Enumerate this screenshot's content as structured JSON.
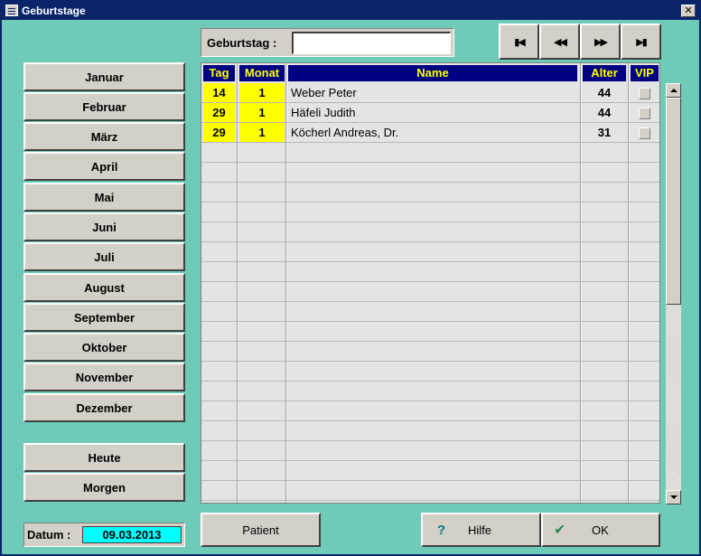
{
  "window": {
    "title": "Geburtstage",
    "close_label": "✕"
  },
  "search": {
    "label": "Geburtstag :",
    "value": ""
  },
  "nav": {
    "first": "▮◀",
    "prev": "◀◀",
    "next": "▶▶",
    "last": "▶▮"
  },
  "months": [
    "Januar",
    "Februar",
    "März",
    "April",
    "Mai",
    "Juni",
    "Juli",
    "August",
    "September",
    "Oktober",
    "November",
    "Dezember"
  ],
  "quick": {
    "today": "Heute",
    "tomorrow": "Morgen"
  },
  "datum": {
    "label": "Datum :",
    "value": "09.03.2013"
  },
  "table": {
    "headers": {
      "tag": "Tag",
      "monat": "Monat",
      "name": "Name",
      "alter": "Alter",
      "vip": "VIP"
    },
    "rows": [
      {
        "tag": "14",
        "monat": "1",
        "name": "Weber Peter",
        "alter": "44",
        "vip": false
      },
      {
        "tag": "29",
        "monat": "1",
        "name": "Häfeli Judith",
        "alter": "44",
        "vip": false
      },
      {
        "tag": "29",
        "monat": "1",
        "name": "Köcherl Andreas, Dr.",
        "alter": "31",
        "vip": false
      }
    ]
  },
  "buttons": {
    "patient": "Patient",
    "help": "Hilfe",
    "help_glyph": "?",
    "ok": "OK",
    "ok_glyph": "✔"
  },
  "colors": {
    "window_bg": "#6ecbb8",
    "header_bg": "#000080",
    "header_fg": "#ffff00",
    "highlight": "#ffff00",
    "datum_bg": "#00ffff"
  }
}
